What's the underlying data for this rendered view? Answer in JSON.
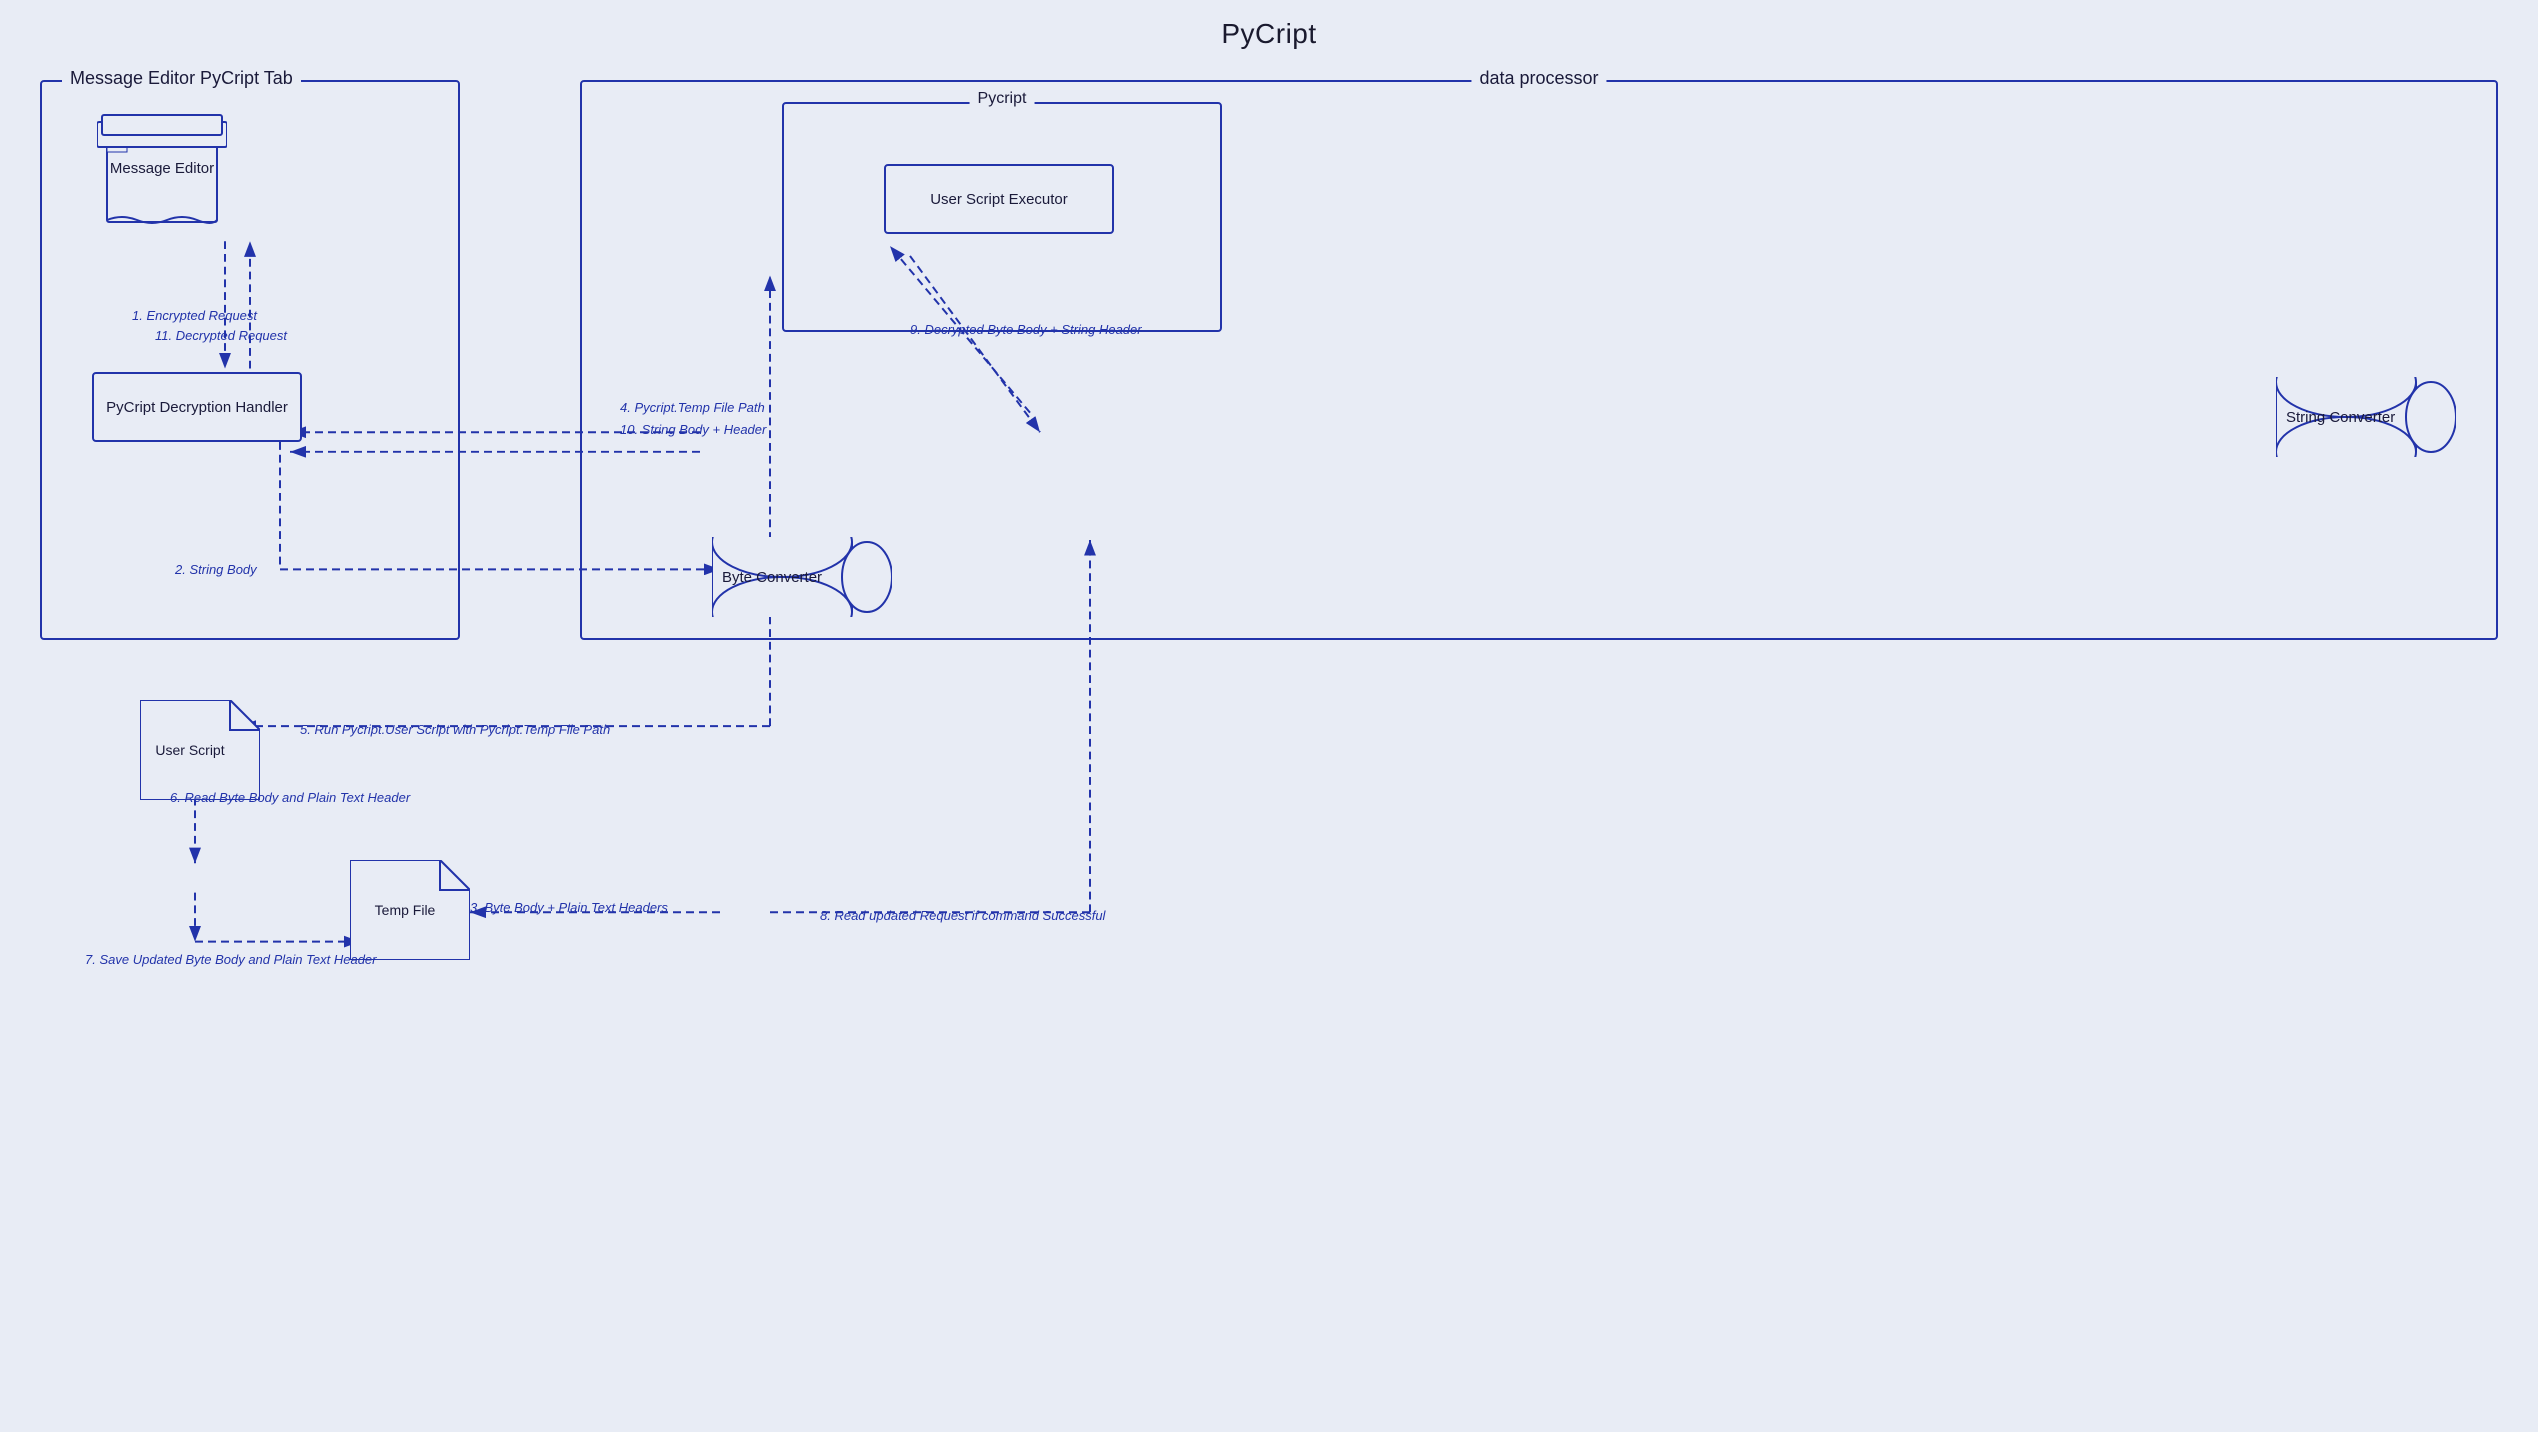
{
  "title": "PyCript",
  "leftPanel": {
    "title": "Message Editor PyCript Tab"
  },
  "rightPanel": {
    "title": "data processor"
  },
  "pycriptPanel": {
    "title": "Pycript"
  },
  "components": {
    "messageEditor": "Message Editor",
    "decryptionHandler": "PyCript Decryption Handler",
    "userScriptExecutor": "User Script Executor",
    "stringConverter": "String Converter",
    "byteConverter": "Byte Converter",
    "userScript": "User Script",
    "tempFile": "Temp File"
  },
  "arrows": {
    "a1": "1. Encrypted Request",
    "a2": "11. Decrypted Request",
    "a3": "2. String Body",
    "a4": "4. Pycript.Temp File Path",
    "a5": "10. String Body + Header",
    "a6": "9. Decrypted Byte Body + String Header",
    "a7": "5. Run Pycript.User Script with Pycript.Temp File Path",
    "a8": "6. Read Byte Body and Plain Text Header",
    "a9": "7. Save Updated Byte Body and Plain Text Header",
    "a10": "3. Byte Body + Plain Text Headers",
    "a11": "8. Read updated Request if command Successful"
  },
  "colors": {
    "blue": "#2233aa",
    "bg": "#e8ecf5",
    "text": "#1a1a3a"
  }
}
